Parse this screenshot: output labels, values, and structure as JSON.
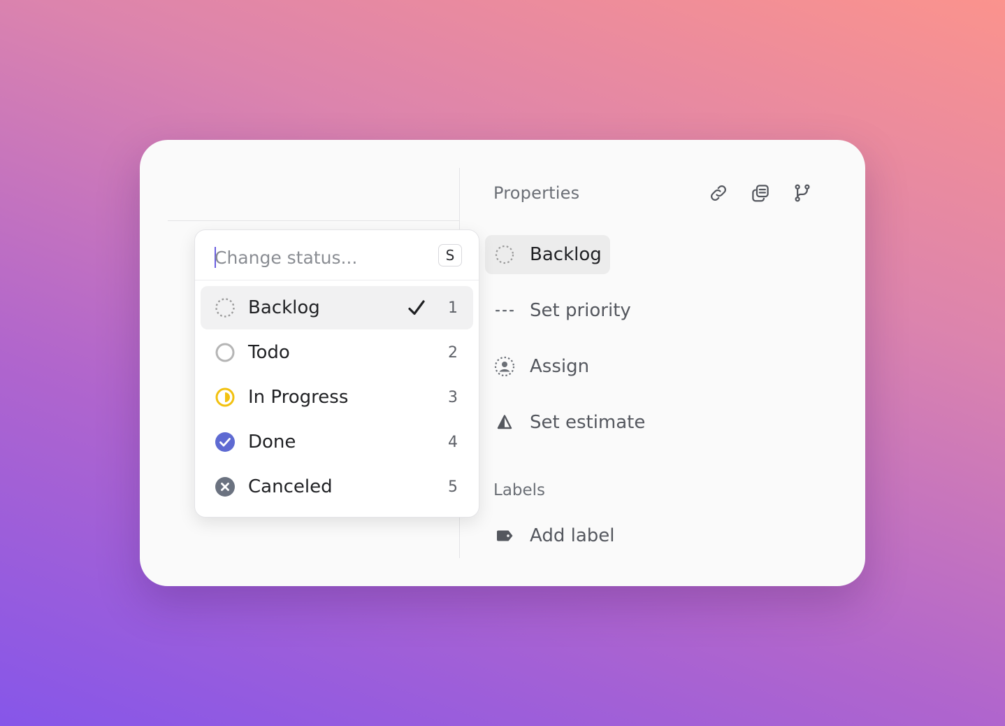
{
  "properties": {
    "title": "Properties",
    "items": [
      {
        "label": "Backlog",
        "icon": "backlog-icon"
      },
      {
        "label": "Set priority",
        "icon": "no-priority-icon"
      },
      {
        "label": "Assign",
        "icon": "assignee-icon"
      },
      {
        "label": "Set estimate",
        "icon": "estimate-icon"
      }
    ],
    "header_icons": [
      "link-icon",
      "copy-icon",
      "branch-icon"
    ]
  },
  "labels": {
    "title": "Labels",
    "add_label": "Add label",
    "icon": "tag-icon"
  },
  "status_menu": {
    "placeholder": "Change status...",
    "shortcut": "S",
    "selected": "Backlog",
    "options": [
      {
        "label": "Backlog",
        "number": "1",
        "icon": "backlog-dashed-circle-icon"
      },
      {
        "label": "Todo",
        "number": "2",
        "icon": "todo-circle-icon"
      },
      {
        "label": "In Progress",
        "number": "3",
        "icon": "in-progress-icon"
      },
      {
        "label": "Done",
        "number": "4",
        "icon": "done-check-icon"
      },
      {
        "label": "Canceled",
        "number": "5",
        "icon": "canceled-x-icon"
      }
    ]
  },
  "colors": {
    "in_progress": "#f2c110",
    "done": "#5e6ad2",
    "canceled": "#6b7280",
    "todo": "#b5b5b5",
    "backlog": "#9a9a9a"
  }
}
